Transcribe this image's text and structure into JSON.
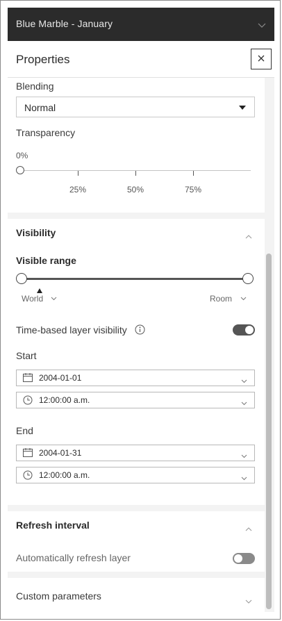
{
  "window": {
    "title": "Blue Marble - January"
  },
  "panel": {
    "title": "Properties"
  },
  "blending": {
    "label": "Blending",
    "value": "Normal"
  },
  "transparency": {
    "label": "Transparency",
    "value_label": "0%",
    "value_percent": 0,
    "ticks": [
      "25%",
      "50%",
      "75%"
    ]
  },
  "visibility": {
    "label": "Visibility",
    "visible_range_label": "Visible range",
    "min_scale": "World",
    "max_scale": "Room",
    "time_based_label": "Time-based layer visibility",
    "time_based_enabled": true,
    "start": {
      "label": "Start",
      "date": "2004-01-01",
      "time": "12:00:00 a.m."
    },
    "end": {
      "label": "End",
      "date": "2004-01-31",
      "time": "12:00:00 a.m."
    }
  },
  "refresh": {
    "label": "Refresh interval",
    "auto_label": "Automatically refresh layer",
    "auto_enabled": false
  },
  "custom": {
    "label": "Custom parameters"
  },
  "colors": {
    "titlebar": "#2b2b2b",
    "toggle_on": "#555555",
    "toggle_off": "#8a8a8a"
  }
}
